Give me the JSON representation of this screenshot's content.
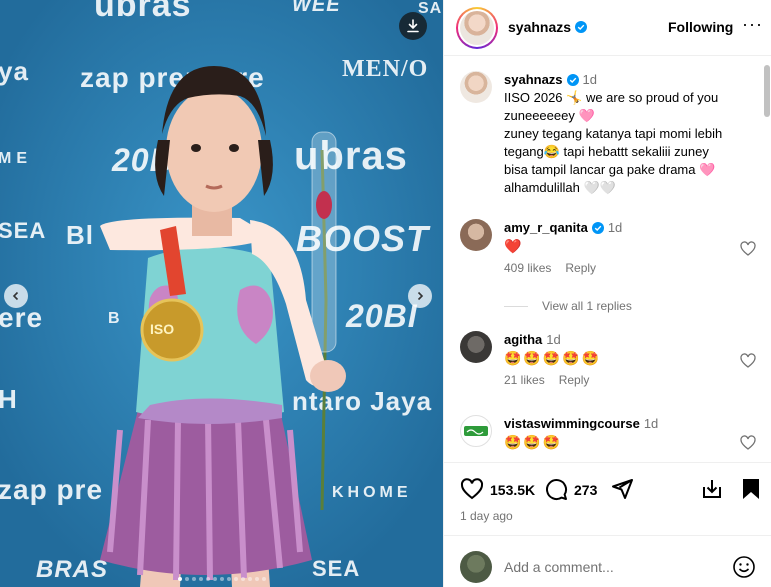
{
  "media": {
    "backdrop_logos": [
      "ubras",
      "WEE",
      "SA",
      "ya",
      "zap premiere",
      "MEN/O",
      "ME",
      "20B",
      "ubras",
      "SEA",
      "Bl",
      "BOOST",
      "ere",
      "B",
      "20BI",
      "H",
      "ntaro Jaya",
      "zap pre",
      "KHOME",
      "BRAS",
      "SEA"
    ],
    "medal_text": "ISO",
    "carousel_count": 13,
    "carousel_active": 1
  },
  "header": {
    "username": "syahnazs",
    "follow_label": "Following",
    "more_label": "···"
  },
  "caption": {
    "username": "syahnazs",
    "time": "1d",
    "text": "IISO 2026 🤸 we are so proud of you zuneeeeeey 🩷\nzuney tegang katanya tapi momi lebih tegang😂 tapi hebattt sekaliii zuney bisa tampil lancar ga pake drama 🩷 alhamdulillah 🤍🤍"
  },
  "comments": [
    {
      "username": "amy_r_qanita",
      "verified": true,
      "time": "1d",
      "text": "❤️",
      "likes": "409 likes",
      "reply": "Reply"
    },
    {
      "username": "agitha",
      "verified": false,
      "time": "1d",
      "text": "🤩🤩🤩🤩🤩",
      "likes": "21 likes",
      "reply": "Reply"
    },
    {
      "username": "vistaswimmingcourse",
      "verified": false,
      "time": "1d",
      "text": "🤩🤩🤩"
    }
  ],
  "view_replies": "View all 1 replies",
  "actions": {
    "likes": "153.5K",
    "comments": "273",
    "time_ago": "1 day ago"
  },
  "add_comment": {
    "placeholder": "Add a comment..."
  },
  "colors": {
    "verified": "#0095f6",
    "heart": "#ff3040",
    "muted": "#737373"
  }
}
